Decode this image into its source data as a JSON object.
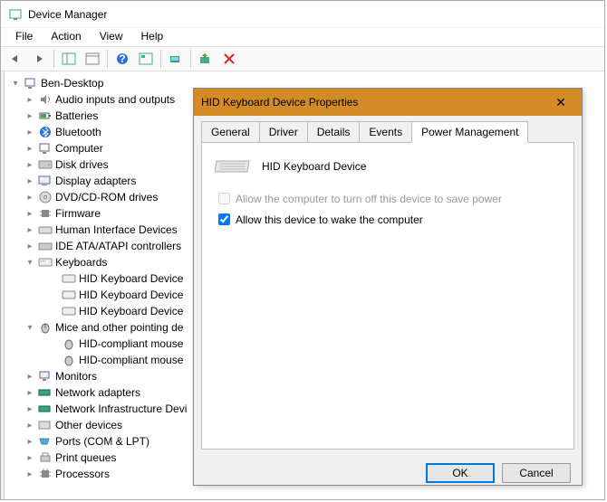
{
  "window": {
    "title": "Device Manager"
  },
  "menu": {
    "file": "File",
    "action": "Action",
    "view": "View",
    "help": "Help"
  },
  "tree": {
    "root": "Ben-Desktop",
    "items": {
      "audio": "Audio inputs and outputs",
      "batteries": "Batteries",
      "bluetooth": "Bluetooth",
      "computer": "Computer",
      "disk": "Disk drives",
      "display": "Display adapters",
      "dvd": "DVD/CD-ROM drives",
      "firmware": "Firmware",
      "hid": "Human Interface Devices",
      "ide": "IDE ATA/ATAPI controllers",
      "keyboards": "Keyboards",
      "kbd1": "HID Keyboard Device",
      "kbd2": "HID Keyboard Device",
      "kbd3": "HID Keyboard Device",
      "mice": "Mice and other pointing de",
      "mouse1": "HID-compliant mouse",
      "mouse2": "HID-compliant mouse",
      "monitors": "Monitors",
      "netadapters": "Network adapters",
      "netinfra": "Network Infrastructure Devi",
      "other": "Other devices",
      "ports": "Ports (COM & LPT)",
      "printqueues": "Print queues",
      "processors": "Processors"
    }
  },
  "dialog": {
    "title": "HID Keyboard Device Properties",
    "tabs": {
      "general": "General",
      "driver": "Driver",
      "details": "Details",
      "events": "Events",
      "power": "Power Management"
    },
    "device_name": "HID Keyboard Device",
    "checkbox1": "Allow the computer to turn off this device to save power",
    "checkbox2": "Allow this device to wake the computer",
    "ok": "OK",
    "cancel": "Cancel"
  }
}
